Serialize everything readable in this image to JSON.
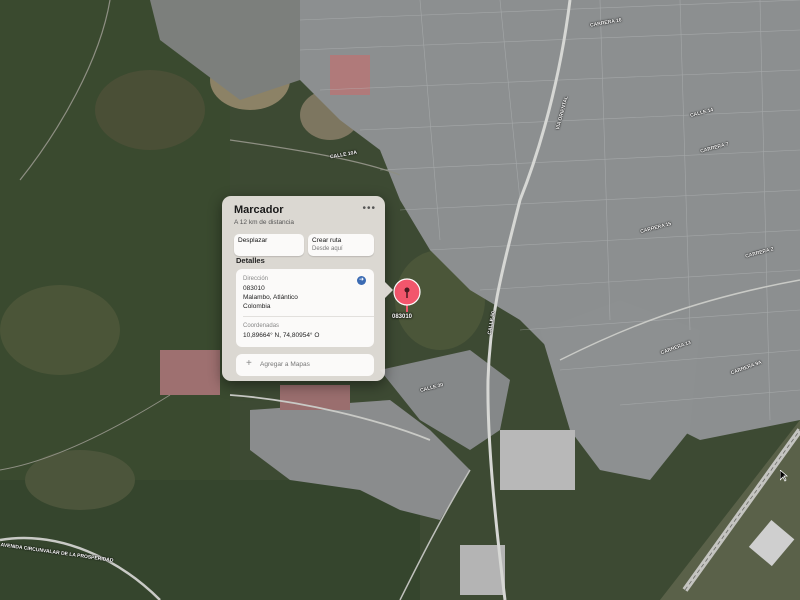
{
  "popup": {
    "title": "Marcador",
    "more_icon": "ellipsis-icon",
    "distance": "A 12 km de distancia",
    "move_label": "Desplazar",
    "route_label": "Crear ruta",
    "route_sub": "Desde aquí",
    "details_heading": "Detalles",
    "address_label": "Dirección",
    "address_line1": "083010",
    "address_line2": "Malambo, Atlántico",
    "address_line3": "Colombia",
    "coords_label": "Coordenadas",
    "coords_value": "10,89664° N, 74,80954° O",
    "add_label": "Agregar a Mapas"
  },
  "pin": {
    "label": "083010",
    "color": "#f2566c"
  },
  "streets": {
    "s1": "CALLE 10A",
    "s2": "CALLE 50",
    "s3": "CARRERA 16",
    "s4": "CARRERA 7",
    "s5": "CARRERA 15",
    "s6": "CALLE 14",
    "s7": "VÍA ORIENTAL",
    "s8": "CARRERA 13",
    "s9": "CALLE 30",
    "s10": "CARRERA 9A",
    "s11": "CARRERA 2",
    "s12": "AVENIDA CIRCUNVALAR DE LA PROSPERIDAD"
  }
}
